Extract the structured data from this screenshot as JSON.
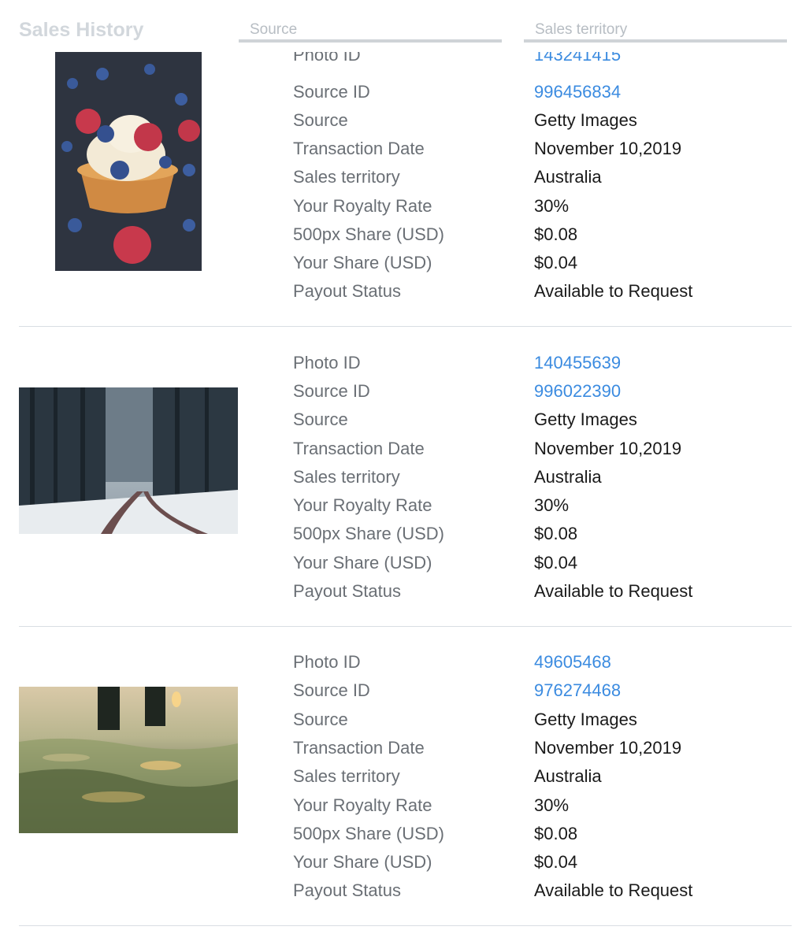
{
  "header": {
    "title": "Sales History",
    "filters": {
      "source_placeholder": "Source",
      "territory_placeholder": "Sales territory"
    }
  },
  "labels": {
    "photo_id": "Photo ID",
    "source_id": "Source ID",
    "source": "Source",
    "transaction_date": "Transaction Date",
    "sales_territory": "Sales territory",
    "royalty_rate": "Your Royalty Rate",
    "px_share": "500px Share (USD)",
    "your_share": "Your Share (USD)",
    "payout_status": "Payout Status"
  },
  "sales": [
    {
      "photo": "cupcake with raspberries and blueberries",
      "photo_id": "143241415",
      "source_id": "996456834",
      "source": "Getty Images",
      "transaction_date": "November 10,2019",
      "sales_territory": "Australia",
      "royalty_rate": "30%",
      "px_share": "$0.08",
      "your_share": "$0.04",
      "payout_status": "Available to Request"
    },
    {
      "photo": "snowy forest road",
      "photo_id": "140455639",
      "source_id": "996022390",
      "source": "Getty Images",
      "transaction_date": "November 10,2019",
      "sales_territory": "Australia",
      "royalty_rate": "30%",
      "px_share": "$0.08",
      "your_share": "$0.04",
      "payout_status": "Available to Request"
    },
    {
      "photo": "water reflection at sunset",
      "photo_id": "49605468",
      "source_id": "976274468",
      "source": "Getty Images",
      "transaction_date": "November 10,2019",
      "sales_territory": "Australia",
      "royalty_rate": "30%",
      "px_share": "$0.08",
      "your_share": "$0.04",
      "payout_status": "Available to Request"
    }
  ],
  "colors": {
    "link": "#3b8be0",
    "label": "#6a6f75",
    "value": "#1a1a1a",
    "divider": "#d9dee3"
  }
}
